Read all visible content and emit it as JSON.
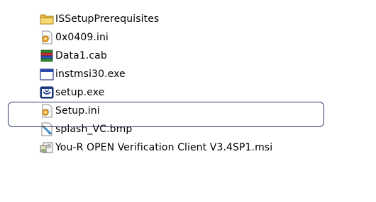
{
  "explorer": {
    "files": [
      {
        "name": "ISSetupPrerequisites",
        "icon": "folder-icon"
      },
      {
        "name": "0x0409.ini",
        "icon": "ini-settings-icon"
      },
      {
        "name": "Data1.cab",
        "icon": "cab-archive-icon"
      },
      {
        "name": "instmsi30.exe",
        "icon": "exe-window-icon"
      },
      {
        "name": "setup.exe",
        "icon": "setup-exe-icon"
      },
      {
        "name": "Setup.ini",
        "icon": "ini-settings-icon"
      },
      {
        "name": "splash_VC.bmp",
        "icon": "bitmap-image-icon"
      },
      {
        "name": "You-R OPEN Verification Client V3.4SP1.msi",
        "icon": "msi-installer-icon"
      }
    ],
    "highlighted": "setup.exe",
    "colors": {
      "highlight_border": "#2a3a6a",
      "folder": "#f0c544",
      "selection_accent": "#1a3a8a"
    }
  }
}
